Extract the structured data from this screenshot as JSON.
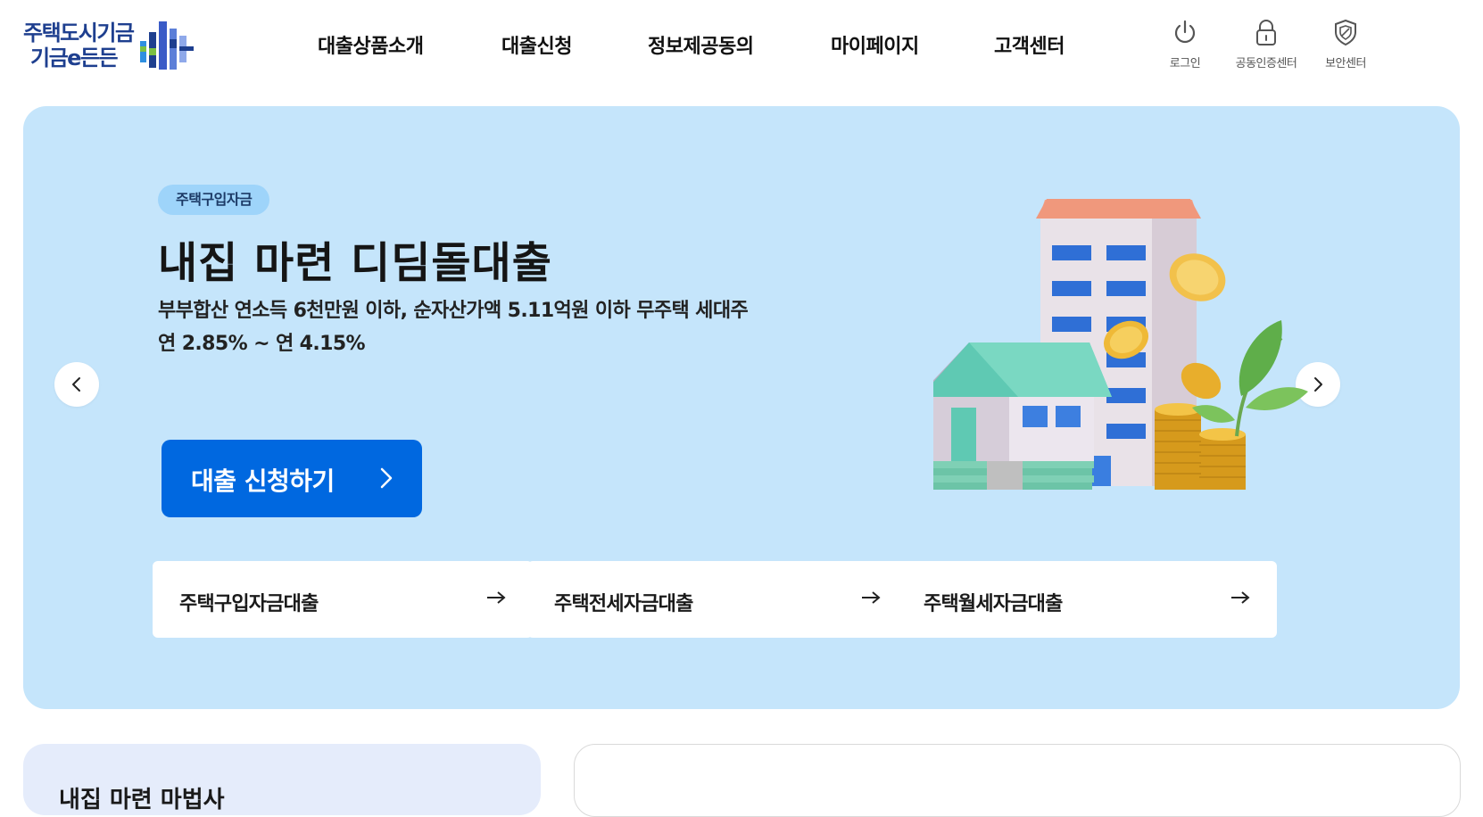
{
  "logo": {
    "line1": "주택도시기금",
    "line2": "기금e든든"
  },
  "nav": {
    "items": [
      "대출상품소개",
      "대출신청",
      "정보제공동의",
      "마이페이지",
      "고객센터"
    ]
  },
  "utility": {
    "login": "로그인",
    "cert_center": "공동인증센터",
    "security_center": "보안센터"
  },
  "hero": {
    "badge": "주택구입자금",
    "title": "내집 마련 디딤돌대출",
    "description": "부부합산 연소득 6천만원 이하, 순자산가액 5.11억원 이하 무주택 세대주",
    "rate": "연 2.85% ~ 연 4.15%",
    "apply_button": "대출 신청하기"
  },
  "quick_links": [
    "주택구입자금대출",
    "주택전세자금대출",
    "주택월세자금대출"
  ],
  "lower": {
    "left_panel_title": "내집 마련 마법사"
  },
  "colors": {
    "brand": "#1e3f8f",
    "hero_bg": "#c5e5fb",
    "button": "#0068e0",
    "badge": "#9ed4fa"
  }
}
